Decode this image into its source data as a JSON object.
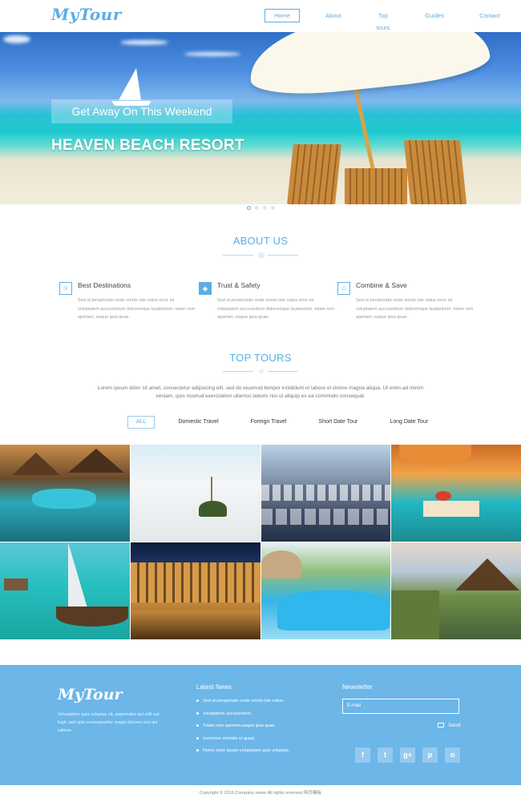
{
  "header": {
    "logo": "MyTour",
    "nav": [
      "Home",
      "About",
      "Top tours",
      "Guides",
      "Contact"
    ]
  },
  "hero": {
    "tagline": "Get Away On This Weekend",
    "title": "HEAVEN BEACH RESORT"
  },
  "about": {
    "title": "ABOUT US",
    "features": [
      {
        "title": "Best Destinations",
        "icon": "map-pin-icon",
        "text": "Sed ut perspiciatis unde omnis iste natus error sit voluptatem accusantium doloremque laudantium, totam rem aperiam, eaque ipsa quae."
      },
      {
        "title": "Trust & Safety",
        "icon": "shield-icon",
        "text": "Sed ut perspiciatis unde omnis iste natus error sit voluptatem accusantium doloremque laudantium, totam rem aperiam, eaque ipsa quae."
      },
      {
        "title": "Combine & Save",
        "icon": "star-icon",
        "text": "Sed ut perspiciatis unde omnis iste natus error sit voluptatem accusantium doloremque laudantium, totam rem aperiam, eaque ipsa quae."
      }
    ]
  },
  "tours": {
    "title": "TOP TOURS",
    "text": "Lorem ipsum dolor sit amet, consectetur adipiscing elit, sed do eiusmod tempor incididunt ut labore et dolore magna aliqua. Ut enim ad minim veniam, quis nostrud exercitation ullamco laboris nisi ut aliquip ex ea commodo consequat.",
    "filters": [
      "ALL",
      "Domestic Travel",
      "Foreign Travel",
      "Short Date Tour",
      "Long Date Tour"
    ]
  },
  "footer": {
    "logo": "MyTour",
    "about": "Voluptatem quia voluptas sit, aspernatur aut odit aut fugit, sed quia consequuntur magni dolores eos qui ratione.",
    "news_title": "Latest News",
    "news": [
      "Sed ut perspiciatis unde omnis iste natus.",
      "Voluptatem accusantium.",
      "Totam rem aperiam,eaque ipsa quae.",
      "Inventore veritatis et quasi.",
      "Nemo enim ipsam voluptatem quia voluptas."
    ],
    "newsletter_title": "Newsletter",
    "email_placeholder": "E-mail",
    "send_label": "Send",
    "socials": [
      "f",
      "t",
      "g+",
      "p",
      "o"
    ]
  },
  "copyright": "Copyright © 2016 Company name All rights reserved 网页模板",
  "colors": {
    "accent": "#5aaee6",
    "footer_bg": "#6cb6e8"
  }
}
